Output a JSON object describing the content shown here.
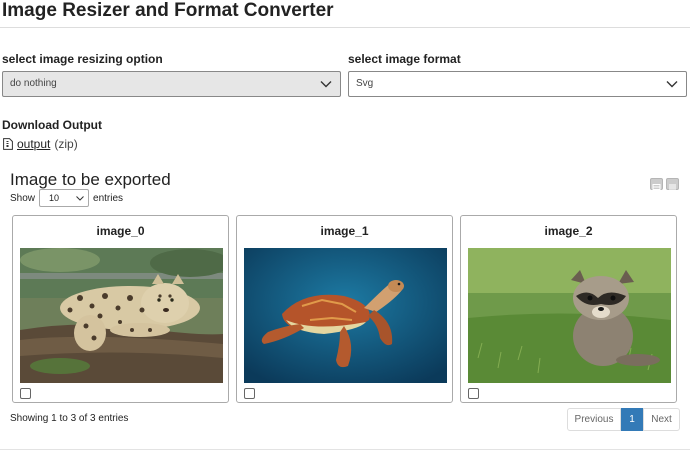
{
  "app": {
    "title": "Image Resizer and Format Converter"
  },
  "resize": {
    "label": "select image resizing option",
    "value": "do nothing"
  },
  "format": {
    "label": "select image format",
    "value": "Svg"
  },
  "download": {
    "label": "Download Output",
    "link_text": "output",
    "suffix": "(zip)"
  },
  "table": {
    "title": "Image to be exported",
    "show_label": "Show",
    "page_size": "10",
    "entries_label": "entries",
    "info": "Showing 1 to 3 of 3 entries",
    "items": [
      {
        "caption": "image_0",
        "subject": "leopard"
      },
      {
        "caption": "image_1",
        "subject": "sea-turtle"
      },
      {
        "caption": "image_2",
        "subject": "raccoon"
      }
    ]
  },
  "pagination": {
    "previous": "Previous",
    "current": "1",
    "next": "Next"
  },
  "colors": {
    "accent": "#337ab7",
    "disabled_select_bg": "#e6e6e6"
  }
}
